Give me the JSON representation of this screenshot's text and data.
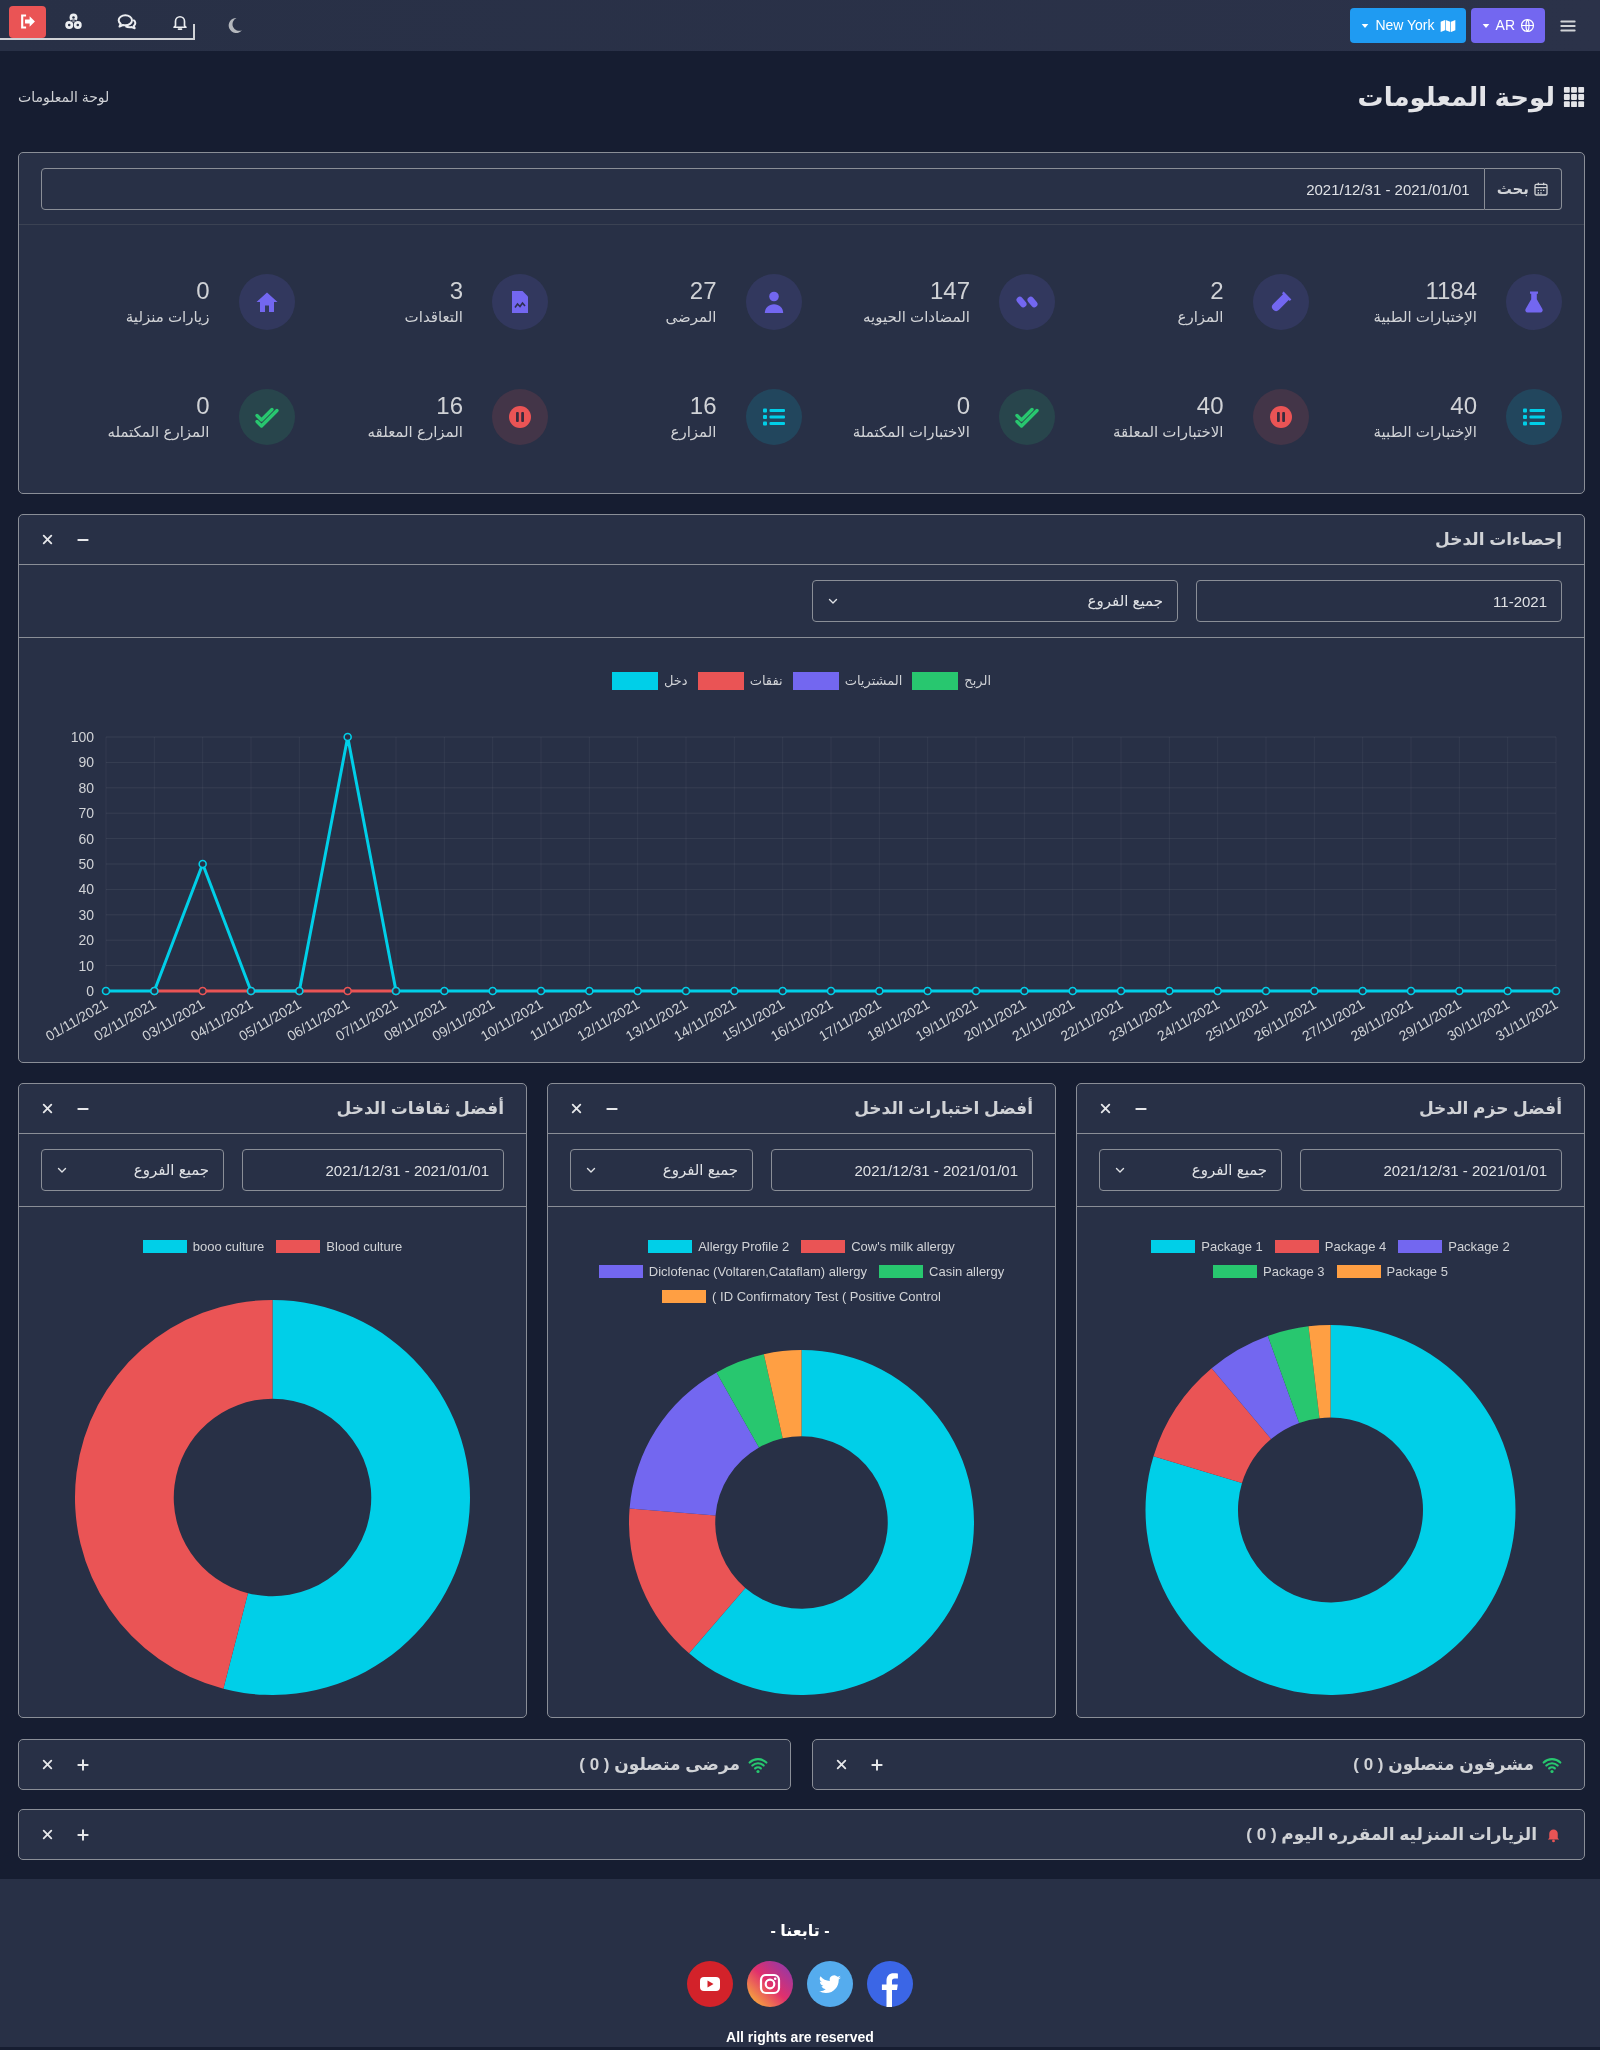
{
  "navbar": {
    "language_button": {
      "label": "AR"
    },
    "branch_button": {
      "label": "New York"
    }
  },
  "page_header": {
    "title": "لوحة المعلومات",
    "breadcrumb": "لوحة المعلومات"
  },
  "summary": {
    "search_label": "بحث",
    "date_range": "2021/12/31 - 2021/01/01",
    "stats": [
      {
        "value": "1184",
        "label": "الإختبارات الطبية",
        "color": "#7367f0"
      },
      {
        "value": "2",
        "label": "المزارع",
        "color": "#7367f0"
      },
      {
        "value": "147",
        "label": "المضادات الحيويه",
        "color": "#7367f0"
      },
      {
        "value": "27",
        "label": "المرضى",
        "color": "#7367f0"
      },
      {
        "value": "3",
        "label": "التعاقدات",
        "color": "#7367f0"
      },
      {
        "value": "0",
        "label": "زيارات منزلية",
        "color": "#7367f0"
      },
      {
        "value": "40",
        "label": "الإختبارات الطبية",
        "color": "#00cfe8"
      },
      {
        "value": "40",
        "label": "الاختبارات المعلقة",
        "color": "#ea5455"
      },
      {
        "value": "0",
        "label": "الاختبارات المكتملة",
        "color": "#28c76f"
      },
      {
        "value": "16",
        "label": "المزارع",
        "color": "#00cfe8"
      },
      {
        "value": "16",
        "label": "المزارع المعلقه",
        "color": "#ea5455"
      },
      {
        "value": "0",
        "label": "المزارع المكتمله",
        "color": "#28c76f"
      }
    ]
  },
  "income_stats": {
    "title": "إحصاءات الدخل",
    "expanded": true,
    "month": "11-2021",
    "branch": "جميع الفروع",
    "chart_data": {
      "type": "line",
      "legend": "top",
      "grid": true,
      "categories": [
        "01/11/2021",
        "02/11/2021",
        "03/11/2021",
        "04/11/2021",
        "05/11/2021",
        "06/11/2021",
        "07/11/2021",
        "08/11/2021",
        "09/11/2021",
        "10/11/2021",
        "11/11/2021",
        "12/11/2021",
        "13/11/2021",
        "14/11/2021",
        "15/11/2021",
        "16/11/2021",
        "17/11/2021",
        "18/11/2021",
        "19/11/2021",
        "20/11/2021",
        "21/11/2021",
        "22/11/2021",
        "23/11/2021",
        "24/11/2021",
        "25/11/2021",
        "26/11/2021",
        "27/11/2021",
        "28/11/2021",
        "29/11/2021",
        "30/11/2021",
        "31/11/2021"
      ],
      "series": [
        {
          "name": "دخل",
          "color": "#00cfe8",
          "marker": "circle",
          "values": [
            0,
            0,
            50,
            0,
            0,
            100,
            0,
            0,
            0,
            0,
            0,
            0,
            0,
            0,
            0,
            0,
            0,
            0,
            0,
            0,
            0,
            0,
            0,
            0,
            0,
            0,
            0,
            0,
            0,
            0,
            0
          ]
        },
        {
          "name": "نفقات",
          "color": "#ea5455",
          "marker": "circle",
          "values": [
            null,
            0,
            0,
            0,
            0,
            0,
            0,
            null,
            null,
            null,
            null,
            null,
            null,
            null,
            null,
            null,
            null,
            null,
            null,
            null,
            null,
            null,
            null,
            null,
            null,
            null,
            null,
            null,
            null,
            null,
            null
          ]
        },
        {
          "name": "المشتريات",
          "color": "#7367f0",
          "values": [
            null,
            null,
            null,
            null,
            null,
            null,
            null,
            null,
            null,
            null,
            null,
            null,
            null,
            null,
            null,
            null,
            null,
            null,
            null,
            null,
            null,
            null,
            null,
            null,
            null,
            null,
            null,
            null,
            null,
            null,
            null
          ]
        },
        {
          "name": "الربح",
          "color": "#28c76f",
          "values": [
            null,
            null,
            null,
            null,
            null,
            null,
            null,
            null,
            null,
            null,
            null,
            null,
            null,
            null,
            null,
            null,
            null,
            null,
            null,
            null,
            null,
            null,
            null,
            null,
            null,
            null,
            null,
            null,
            null,
            null,
            null
          ]
        }
      ],
      "ylim": [
        0,
        100
      ],
      "yticks": [
        0,
        10,
        20,
        30,
        40,
        50,
        60,
        70,
        80,
        90,
        100
      ]
    }
  },
  "top_panels": [
    {
      "title": "أفضل حزم الدخل",
      "expanded": true,
      "date_range": "2021/12/31 - 2021/01/01",
      "branch": "جميع الفروع",
      "legend": [
        {
          "label": "Package 2",
          "color": "#7367f0"
        },
        {
          "label": "Package 4",
          "color": "#ea5455"
        },
        {
          "label": "Package 1",
          "color": "#00cfe8"
        },
        {
          "label": "Package 5",
          "color": "#ff9f43"
        },
        {
          "label": "Package 3",
          "color": "#28c76f"
        }
      ]
    },
    {
      "title": "أفضل اختبارات الدخل",
      "expanded": true,
      "date_range": "2021/12/31 - 2021/01/01",
      "branch": "جميع الفروع",
      "legend": [
        {
          "label": "Cow's milk allergy",
          "color": "#ea5455"
        },
        {
          "label": "Allergy Profile 2",
          "color": "#00cfe8"
        },
        {
          "label": "Casin allergy",
          "color": "#28c76f"
        },
        {
          "label": "Diclofenac (Voltaren,Cataflam) allergy",
          "color": "#7367f0"
        },
        {
          "label": "( ID Confirmatory Test ( Positive Control",
          "color": "#ff9f43"
        }
      ]
    },
    {
      "title": "أفضل ثقافات الدخل",
      "expanded": true,
      "date_range": "2021/12/31 - 2021/01/01",
      "branch": "جميع الفروع",
      "legend": [
        {
          "label": "Blood culture",
          "color": "#ea5455"
        },
        {
          "label": "booo culture",
          "color": "#00cfe8"
        }
      ]
    }
  ],
  "online_panels": [
    {
      "title": "مشرفون متصلون ( 0 )",
      "expanded": false
    },
    {
      "title": "مرضى متصلون ( 0 )",
      "expanded": false
    }
  ],
  "home_visits": {
    "title": "الزيارات المنزليه المقرره اليوم ( 0 )",
    "expanded": false
  },
  "footer": {
    "follow_title": "- تابعنا -",
    "copyright": "All rights are reserved"
  }
}
